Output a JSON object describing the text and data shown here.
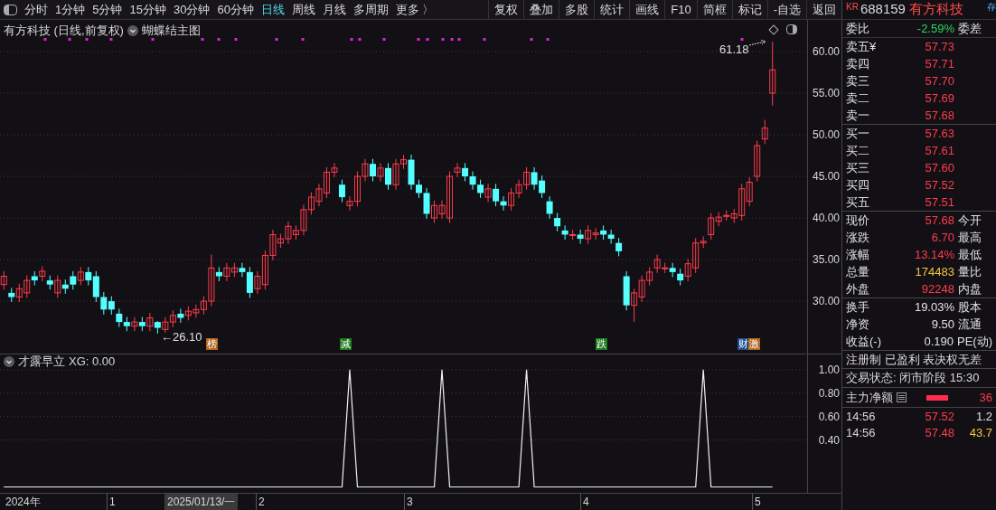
{
  "toolbar": {
    "periods": [
      {
        "label": "分时",
        "selected": false
      },
      {
        "label": "1分钟",
        "selected": false
      },
      {
        "label": "5分钟",
        "selected": false
      },
      {
        "label": "15分钟",
        "selected": false
      },
      {
        "label": "30分钟",
        "selected": false
      },
      {
        "label": "60分钟",
        "selected": false
      },
      {
        "label": "日线",
        "selected": true
      },
      {
        "label": "周线",
        "selected": false
      },
      {
        "label": "月线",
        "selected": false
      },
      {
        "label": "多周期",
        "selected": false
      },
      {
        "label": "更多 〉",
        "selected": false
      }
    ],
    "actions": [
      "复权",
      "叠加",
      "多股",
      "统计",
      "画线",
      "F10",
      "简框",
      "标记",
      "-自选",
      "返回"
    ]
  },
  "main_chart": {
    "title": "有方科技 (日线,前复权)",
    "indicator_name": "蝴蝶结主图",
    "high_label": "61.18",
    "low_label": "←26.10",
    "chart_data": {
      "type": "candlestick",
      "grid": true,
      "ylim": [
        23.6,
        63.8
      ],
      "yticks": [
        {
          "value": 60,
          "label": "60.00"
        },
        {
          "value": 55,
          "label": "55.00"
        },
        {
          "value": 50,
          "label": "50.00"
        },
        {
          "value": 45,
          "label": "45.00"
        },
        {
          "value": 40,
          "label": "40.00"
        },
        {
          "value": 35,
          "label": "35.00"
        },
        {
          "value": 30,
          "label": "30.00"
        }
      ],
      "ohlc": [
        [
          32,
          33.6,
          31.4,
          33
        ],
        [
          31,
          31.6,
          29.9,
          30.5
        ],
        [
          30.5,
          32.1,
          29.9,
          31.5
        ],
        [
          31,
          33.1,
          30.4,
          32.5
        ],
        [
          33,
          33.6,
          31.9,
          32.5
        ],
        [
          33,
          34.2,
          32.4,
          33.6
        ],
        [
          32.5,
          33.1,
          31.4,
          32
        ],
        [
          31,
          33.1,
          30.4,
          32.5
        ],
        [
          32,
          32.6,
          30.9,
          31.5
        ],
        [
          33,
          33.6,
          31.4,
          32
        ],
        [
          32.5,
          34.1,
          31.9,
          33.5
        ],
        [
          33.5,
          34.1,
          31.9,
          32.5
        ],
        [
          33,
          33.6,
          29.9,
          30.5
        ],
        [
          30.5,
          31.1,
          28.4,
          29
        ],
        [
          30,
          30.6,
          28.4,
          29
        ],
        [
          28.5,
          29.1,
          26.9,
          27.5
        ],
        [
          27.5,
          28.1,
          26.4,
          27
        ],
        [
          27,
          28.1,
          26.4,
          27.5
        ],
        [
          27.5,
          28.1,
          26.4,
          27
        ],
        [
          27,
          28.6,
          26.4,
          28
        ],
        [
          27.5,
          27.6,
          26.1,
          26.8
        ],
        [
          26.6,
          28.1,
          26.2,
          27.5
        ],
        [
          27.5,
          28.9,
          26.9,
          28.3
        ],
        [
          28.5,
          29.1,
          27.4,
          28
        ],
        [
          28.3,
          29.4,
          27.7,
          28.8
        ],
        [
          28.6,
          29.6,
          28,
          29
        ],
        [
          29,
          30.6,
          28.4,
          30
        ],
        [
          30,
          35.6,
          29.4,
          34
        ],
        [
          33.5,
          34.1,
          32.4,
          33
        ],
        [
          33,
          34.6,
          32.4,
          34
        ],
        [
          33.5,
          34.6,
          32.9,
          34
        ],
        [
          34,
          34.6,
          32.9,
          33.5
        ],
        [
          33.5,
          34.1,
          30.4,
          31
        ],
        [
          31.5,
          33.6,
          30.9,
          33
        ],
        [
          32,
          36.1,
          31.4,
          35.5
        ],
        [
          35.5,
          38.6,
          34.9,
          38
        ],
        [
          37,
          38.1,
          36.4,
          37.5
        ],
        [
          37.5,
          39.6,
          36.9,
          39
        ],
        [
          38,
          39.1,
          37.4,
          38.5
        ],
        [
          38.5,
          41.6,
          37.9,
          41
        ],
        [
          41,
          43.1,
          40.4,
          42.5
        ],
        [
          42,
          44.1,
          41.4,
          43.5
        ],
        [
          43,
          46.1,
          42.4,
          45.5
        ],
        [
          45.5,
          46.6,
          44.9,
          46
        ],
        [
          44,
          44.6,
          41.9,
          42.5
        ],
        [
          41.5,
          42.6,
          40.9,
          42
        ],
        [
          42,
          45.6,
          41.4,
          45
        ],
        [
          45,
          47.1,
          44.4,
          46.5
        ],
        [
          46.5,
          47.1,
          44.4,
          45
        ],
        [
          45,
          46.6,
          44.4,
          46
        ],
        [
          46,
          46.6,
          43.4,
          44
        ],
        [
          44,
          47.1,
          43.4,
          46.5
        ],
        [
          46.5,
          47.6,
          45.9,
          47
        ],
        [
          47,
          47.6,
          43.4,
          44
        ],
        [
          44,
          44.6,
          42.4,
          43
        ],
        [
          43,
          43.6,
          39.9,
          40.5
        ],
        [
          40,
          42.1,
          39.4,
          41.5
        ],
        [
          40.5,
          42.1,
          39.9,
          41.5
        ],
        [
          40,
          45.6,
          39.4,
          45
        ],
        [
          45.5,
          46.6,
          44.9,
          46
        ],
        [
          46,
          46.6,
          44.4,
          45
        ],
        [
          45,
          45.6,
          43.4,
          44
        ],
        [
          44,
          44.6,
          42.4,
          43
        ],
        [
          42.5,
          44.1,
          41.9,
          43.5
        ],
        [
          43.5,
          44.1,
          41.4,
          42
        ],
        [
          42,
          42.6,
          40.9,
          41.5
        ],
        [
          41.5,
          43.6,
          40.9,
          43
        ],
        [
          43,
          44.6,
          42.4,
          44
        ],
        [
          44,
          46.1,
          43.4,
          45.5
        ],
        [
          45.5,
          46.1,
          43.4,
          44
        ],
        [
          44.5,
          45.1,
          42.4,
          43
        ],
        [
          42,
          42.6,
          39.9,
          40.5
        ],
        [
          40,
          40.6,
          38.4,
          39
        ],
        [
          38.5,
          39.1,
          37.4,
          38
        ],
        [
          38,
          38.6,
          37.4,
          38
        ],
        [
          38,
          38.6,
          36.9,
          37.5
        ],
        [
          37.5,
          39.1,
          36.9,
          38.5
        ],
        [
          38,
          38.8,
          37.4,
          38.2
        ],
        [
          38.5,
          39.1,
          37.4,
          38
        ],
        [
          38,
          38.6,
          36.9,
          37.5
        ],
        [
          37,
          37.6,
          35.4,
          36
        ],
        [
          33,
          33.6,
          28.9,
          29.5
        ],
        [
          29.5,
          31.5,
          27.5,
          31
        ],
        [
          30.5,
          33.1,
          29.9,
          32.5
        ],
        [
          32.5,
          34.1,
          31.9,
          33.5
        ],
        [
          34,
          35.6,
          33.4,
          35
        ],
        [
          34,
          34.6,
          33.4,
          34
        ],
        [
          34,
          34.6,
          32.9,
          33.5
        ],
        [
          33.3,
          33.9,
          31.9,
          32.5
        ],
        [
          33,
          35.1,
          32.4,
          34.5
        ],
        [
          34,
          37.6,
          33.4,
          37
        ],
        [
          37,
          37.8,
          36.4,
          37.2
        ],
        [
          38,
          40.6,
          37.4,
          40
        ],
        [
          39.6,
          40.7,
          39,
          40.1
        ],
        [
          40.3,
          40.9,
          39.7,
          40.3
        ],
        [
          40,
          41.1,
          39.4,
          40.5
        ],
        [
          40.3,
          44.1,
          39.7,
          43.5
        ],
        [
          42,
          44.9,
          41.4,
          44.3
        ],
        [
          45,
          49.3,
          44.4,
          48.7
        ],
        [
          49.5,
          51.8,
          48.9,
          50.8
        ],
        [
          55,
          61.18,
          53.5,
          57.8
        ],
        null,
        null,
        null,
        null
      ]
    },
    "markers": [
      {
        "text": "榜",
        "color": "#b4641e"
      },
      {
        "text": "减",
        "color": "#1e7a1e"
      },
      {
        "text": "跌",
        "color": "#1e7a1e"
      },
      {
        "text": "财",
        "color": "#1e4f8c"
      },
      {
        "text": "激",
        "color": "#b4641e"
      }
    ]
  },
  "sub_chart": {
    "title": "才露早立",
    "reading": "XG: 0.00",
    "chart_data": {
      "type": "line",
      "grid": true,
      "ylim": [
        -0.05,
        1.13
      ],
      "yticks": [
        {
          "value": 1,
          "label": "1.00"
        },
        {
          "value": 0.8,
          "label": "0.80"
        },
        {
          "value": 0.6,
          "label": "0.60"
        },
        {
          "value": 0.4,
          "label": "0.40"
        }
      ],
      "series": [
        {
          "color": "#f0f0f0",
          "values": [
            0,
            0,
            0,
            0,
            0,
            0,
            0,
            0,
            0,
            0,
            0,
            0,
            0,
            0,
            0,
            0,
            0,
            0,
            0,
            0,
            0,
            0,
            0,
            0,
            0,
            0,
            0,
            0,
            0,
            0,
            0,
            0,
            0,
            0,
            0,
            0,
            0,
            0,
            0,
            0,
            0,
            0,
            0,
            0,
            0,
            1,
            0,
            0,
            0,
            0,
            0,
            0,
            0,
            0,
            0,
            0,
            0,
            1,
            0,
            0,
            0,
            0,
            0,
            0,
            0,
            0,
            0,
            0,
            1,
            0,
            0,
            0,
            0,
            0,
            0,
            0,
            0,
            0,
            0,
            0,
            0,
            0,
            0,
            0,
            0,
            0,
            0,
            0,
            0,
            0,
            0,
            1,
            0,
            0,
            0,
            0,
            0,
            0,
            0,
            0,
            0,
            null,
            null,
            null,
            null
          ]
        }
      ]
    }
  },
  "time_axis": {
    "year": "2024年",
    "cursor_date": "2025/01/13/一",
    "months": [
      "1",
      "2",
      "3",
      "4",
      "5"
    ]
  },
  "quote": {
    "market": "KR",
    "code": "688159",
    "name": "有方科技",
    "badge": "存",
    "ratio": {
      "label": "委比",
      "value": "-2.59%",
      "kind": "down",
      "label2": "委差"
    },
    "asks": [
      {
        "label": "卖五¥",
        "price": "57.73"
      },
      {
        "label": "卖四",
        "price": "57.71"
      },
      {
        "label": "卖三",
        "price": "57.70"
      },
      {
        "label": "卖二",
        "price": "57.69"
      },
      {
        "label": "卖一",
        "price": "57.68"
      }
    ],
    "bids": [
      {
        "label": "买一",
        "price": "57.63"
      },
      {
        "label": "买二",
        "price": "57.61"
      },
      {
        "label": "买三",
        "price": "57.60"
      },
      {
        "label": "买四",
        "price": "57.52"
      },
      {
        "label": "买五",
        "price": "57.51"
      }
    ],
    "stats": [
      {
        "label": "现价",
        "value": "57.68",
        "kind": "up",
        "label2": "今开"
      },
      {
        "label": "涨跌",
        "value": "6.70",
        "kind": "up",
        "label2": "最高"
      },
      {
        "label": "涨幅",
        "value": "13.14%",
        "kind": "up",
        "label2": "最低"
      },
      {
        "label": "总量",
        "value": "174483",
        "kind": "volume",
        "label2": "量比"
      },
      {
        "label": "外盘",
        "value": "92248",
        "kind": "up",
        "label2": "内盘"
      }
    ],
    "stats2": [
      {
        "label": "换手",
        "value": "19.03%",
        "kind": "neutral",
        "label2": "股本"
      },
      {
        "label": "净资",
        "value": "9.50",
        "kind": "neutral",
        "label2": "流通"
      },
      {
        "label": "收益(-)",
        "value": "0.190",
        "kind": "neutral",
        "label2": "PE(动)"
      }
    ],
    "tags": "注册制 已盈利 表决权无差",
    "status": "交易状态: 闭市阶段 15:30",
    "flow": {
      "label": "主力净额",
      "value": "36"
    },
    "ticks": [
      {
        "time": "14:56",
        "price": "57.52",
        "volume": "1.2"
      },
      {
        "time": "14:56",
        "price": "57.48",
        "volume": "43.7"
      }
    ]
  }
}
